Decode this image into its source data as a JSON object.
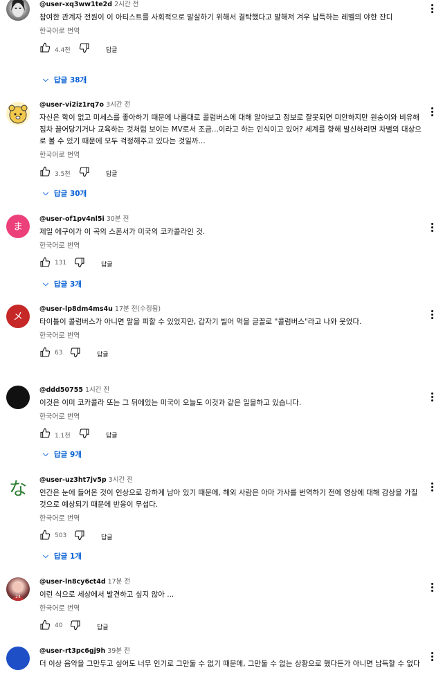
{
  "labels": {
    "translate": "한국어로 번역",
    "reply": "답글"
  },
  "comments": [
    {
      "author": "@user-xq3ww1te2d",
      "time": "2시간 전",
      "text": "참여한 관계자 전원이 이 아티스트를 사회적으로 말살하기 위해서 결탁했다고 말해져 겨우 납득하는 레벨의 야한 잔디",
      "likes": "4.4천",
      "replies": "답글 38개",
      "avatar": "photo-face"
    },
    {
      "author": "@user-vi2iz1rq7o",
      "time": "3시간 전",
      "text": "자신은 학이 없고 미세스를 좋아하기 때문에 나름대로 콜럼버스에 대해 알아보고 정보로 잘못되면 미안하지만 원숭이와 비유해 짐차 끌어당기거나 교육하는 것처럼 보이는 MV로서 조금...이라고 하는 인식이고 있어? 세계를 향해 발신하려면 차별의 대상으로 볼 수 있기 때문에 모두 걱정해주고 있다는 것일까...",
      "likes": "3.5천",
      "replies": "답글 30개",
      "avatar": "cartoon-bear"
    },
    {
      "author": "@user-of1pv4nl5i",
      "time": "30분 전",
      "text": "제일 에구이가 이 곡의 스폰서가 미국의 코카콜라인 것.",
      "likes": "131",
      "replies": "답글 3개",
      "avatar_letter": "ま",
      "avatar_color": "#e91e63"
    },
    {
      "author": "@user-lp8dm4ms4u",
      "time": "17분 전(수정됨)",
      "text": "타이틀이 콜럼버스가 아니면 말을 피할 수 있었지만, 갑자기 빌어 먹을 글꼴로 \"콜럼버스\"라고 나와 웃었다.",
      "likes": "63",
      "replies": "",
      "avatar_letter": "メ",
      "avatar_color": "#c62828"
    },
    {
      "author": "@ddd50755",
      "time": "1시간 전",
      "text": "이것은 이미 코카콜라 또는 그 뒤에있는 미국이 오늘도 이것과 같은 일을하고 있습니다.",
      "likes": "1.1천",
      "replies": "답글 9개",
      "avatar": "black-circle"
    },
    {
      "author": "@user-uz3ht7jv5p",
      "time": "3시간 전",
      "text": "인간은 눈에 들어온 것이 인상으로 강하게 남아 있기 때문에, 해외 사람은 아마 가사를 번역하기 전에 영상에 대해 감상을 가질 것으로 예상되기 때문에 반응이 무섭다.",
      "likes": "503",
      "replies": "답글 1개",
      "avatar_letter": "な",
      "avatar_color": "#2e7d32"
    },
    {
      "author": "@user-ln8cy6ct4d",
      "time": "17분 전",
      "text": "이런 식으로 세상에서 발견하고 싶지 않아 ...",
      "likes": "40",
      "replies": "",
      "avatar": "photo-person"
    },
    {
      "author": "@user-rt3pc6gj9h",
      "time": "39분 전",
      "text": "더 이상 음악을 그만두고 싶어도 너무 인기로 그만둘 수 없기 때문에, 그만둘 수 없는 상황으로 했다든가 아니면 납득할 수 없다",
      "likes": "",
      "replies": "",
      "avatar": "blue-circle"
    }
  ]
}
